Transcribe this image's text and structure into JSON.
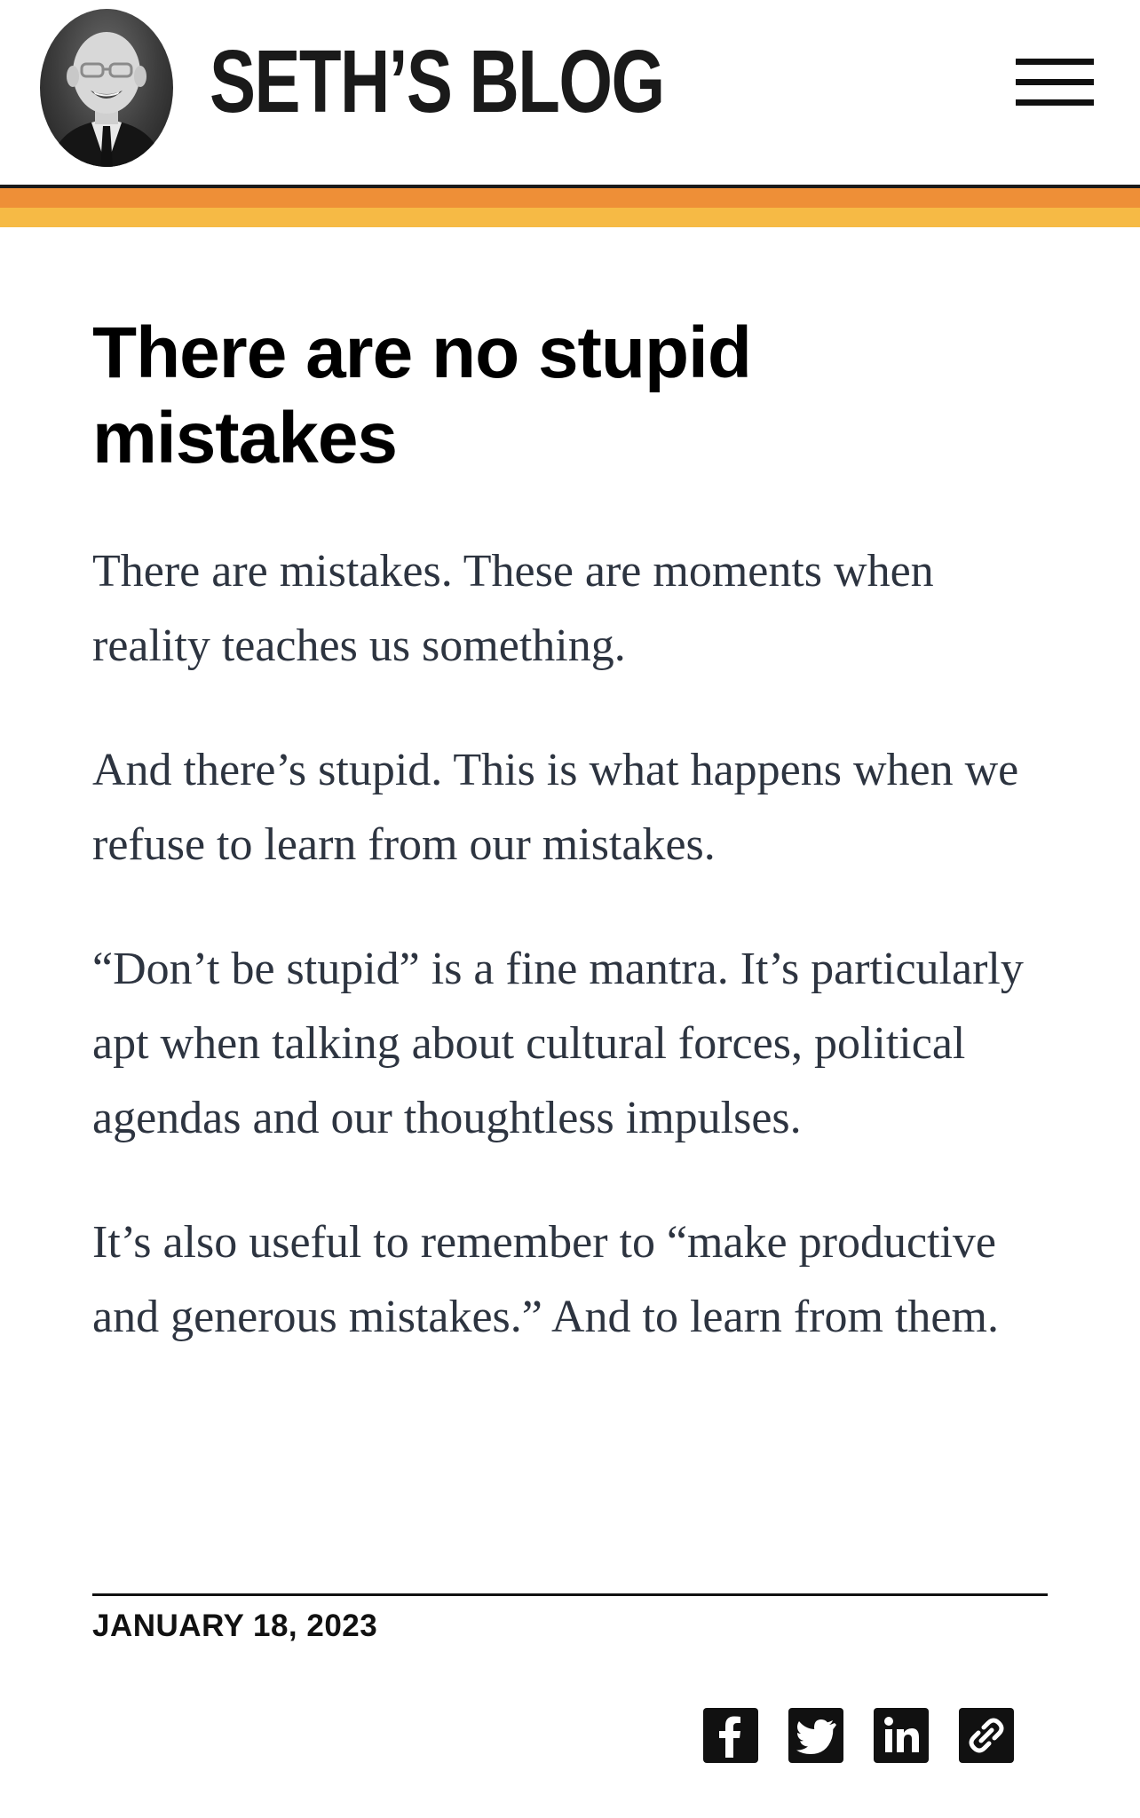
{
  "header": {
    "site_title": "SETH’S BLOG",
    "avatar_icon": "author-portrait",
    "menu_icon": "hamburger-menu-icon"
  },
  "colors": {
    "stripe_black": "#1a1a1a",
    "stripe_orange": "#ee8f37",
    "stripe_yellow": "#f6ba45",
    "body_text": "#2d3440",
    "title_text": "#000000"
  },
  "post": {
    "title": "There are no stupid mistakes",
    "paragraphs": [
      "There are mistakes. These are moments when reality teaches us something.",
      "And there’s stupid. This is what happens when we refuse to learn from our mistakes.",
      "“Don’t be stupid” is a fine mantra. It’s particularly apt when talking about cultural forces, political agendas and our thoughtless impulses.",
      "It’s also useful to remember to “make productive and generous mistakes.” And to learn from them."
    ],
    "date": "JANUARY 18, 2023"
  },
  "share": {
    "icons": [
      "facebook-icon",
      "twitter-icon",
      "linkedin-icon",
      "copy-link-icon"
    ]
  }
}
